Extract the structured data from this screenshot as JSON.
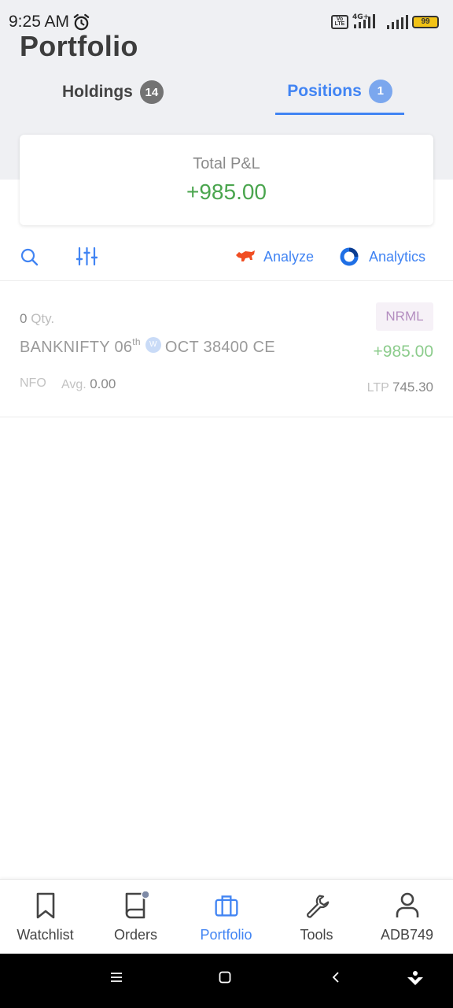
{
  "status_bar": {
    "time": "9:25 AM",
    "network": "4G+",
    "volte": "Vo LTE",
    "battery": "99"
  },
  "page": {
    "title": "Portfolio"
  },
  "tabs": [
    {
      "label": "Holdings",
      "count": "14",
      "active": false
    },
    {
      "label": "Positions",
      "count": "1",
      "active": true
    }
  ],
  "summary": {
    "label": "Total P&L",
    "value": "+985.00"
  },
  "toolbar": {
    "analyze_label": "Analyze",
    "analytics_label": "Analytics"
  },
  "positions": [
    {
      "qty": "0",
      "qty_unit": "Qty.",
      "product": "NRML",
      "symbol": "BANKNIFTY",
      "expiry_day": "06",
      "expiry_suffix": "th",
      "weekly_badge": "W",
      "expiry_rest": "OCT 38400 CE",
      "pnl": "+985.00",
      "exchange": "NFO",
      "avg_label": "Avg.",
      "avg_value": "0.00",
      "ltp_label": "LTP",
      "ltp_value": "745.30"
    }
  ],
  "bottom_nav": [
    {
      "label": "Watchlist",
      "icon": "bookmark-icon",
      "active": false
    },
    {
      "label": "Orders",
      "icon": "book-icon",
      "active": false
    },
    {
      "label": "Portfolio",
      "icon": "briefcase-icon",
      "active": true
    },
    {
      "label": "Tools",
      "icon": "wrench-icon",
      "active": false
    },
    {
      "label": "ADB749",
      "icon": "user-icon",
      "active": false
    }
  ],
  "colors": {
    "accent": "#4184f3",
    "profit": "#4aa54e",
    "header_bg": "#eff0f3",
    "product_badge": "#b48ec0"
  }
}
